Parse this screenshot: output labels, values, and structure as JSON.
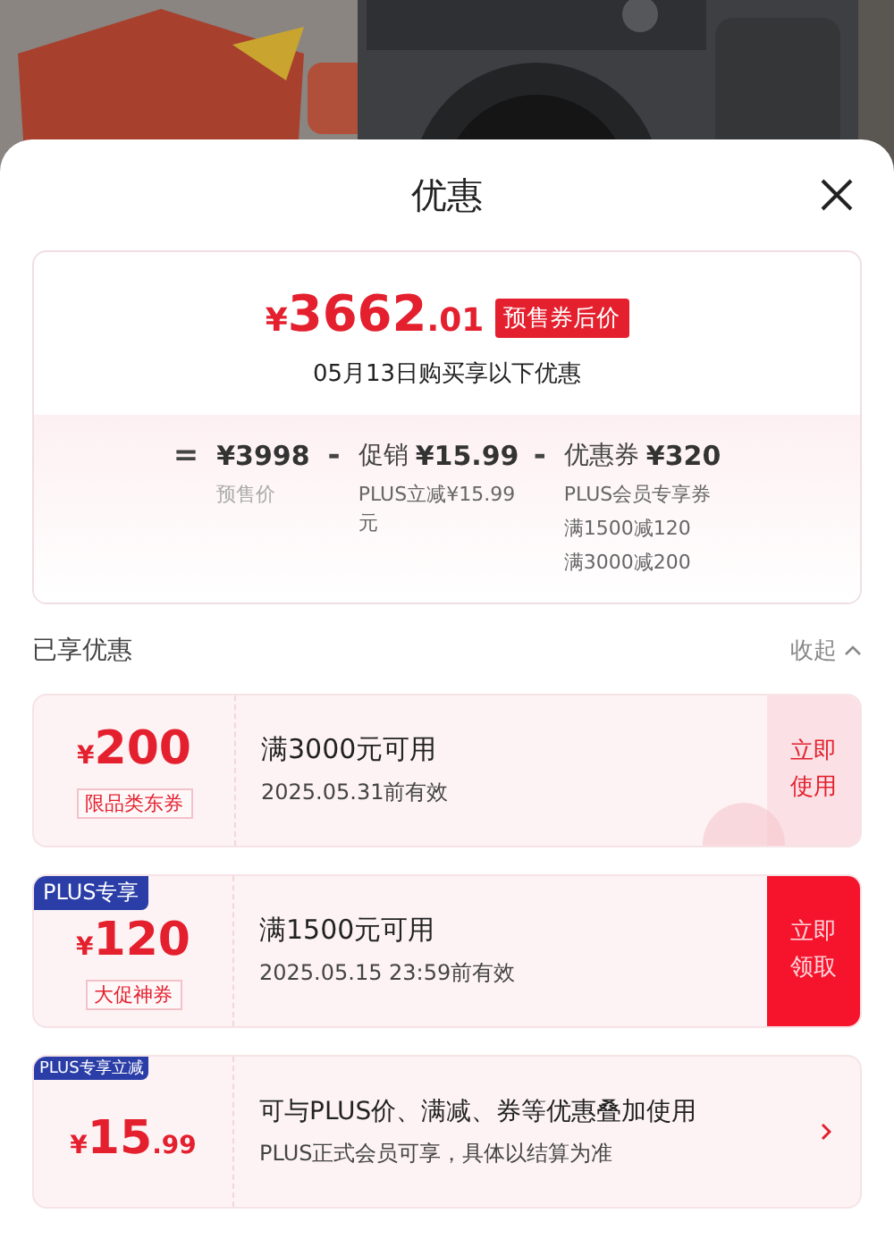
{
  "sheet": {
    "title": "优惠"
  },
  "summary": {
    "price": {
      "symbol": "¥",
      "integer": "3662",
      "decimal": ".01"
    },
    "price_tag": "预售券后价",
    "date_line": "05月13日购买享以下优惠",
    "breakdown": [
      {
        "op": "=",
        "amount": "¥3998",
        "notes": [
          "预售价"
        ]
      },
      {
        "op": "-",
        "label": "促销",
        "amount": "¥15.99",
        "notes": [
          "PLUS立减¥15.99元"
        ]
      },
      {
        "op": "-",
        "label": "优惠券",
        "amount": "¥320",
        "notes": [
          "PLUS会员专享券",
          "满1500减120",
          "满3000减200"
        ]
      }
    ]
  },
  "section": {
    "title": "已享优惠",
    "toggle": "收起"
  },
  "coupons": [
    {
      "kind": "use",
      "symbol": "¥",
      "amount": "200",
      "tag": "限品类东券",
      "condition": "满3000元可用",
      "validity": "2025.05.31前有效",
      "action": "立即使用",
      "claimed": true
    },
    {
      "kind": "claim",
      "badge": "PLUS专享",
      "symbol": "¥",
      "amount": "120",
      "tag": "大促神券",
      "condition": "满1500元可用",
      "validity": "2025.05.15 23:59前有效",
      "action": "立即领取",
      "claimed": false
    },
    {
      "kind": "plus",
      "badge": "PLUS专享立减",
      "symbol": "¥",
      "amount": "15",
      "decimal": ".99",
      "condition": "可与PLUS价、满减、券等优惠叠加使用",
      "validity": "PLUS正式会员可享，具体以结算为准",
      "claimed": false
    }
  ]
}
